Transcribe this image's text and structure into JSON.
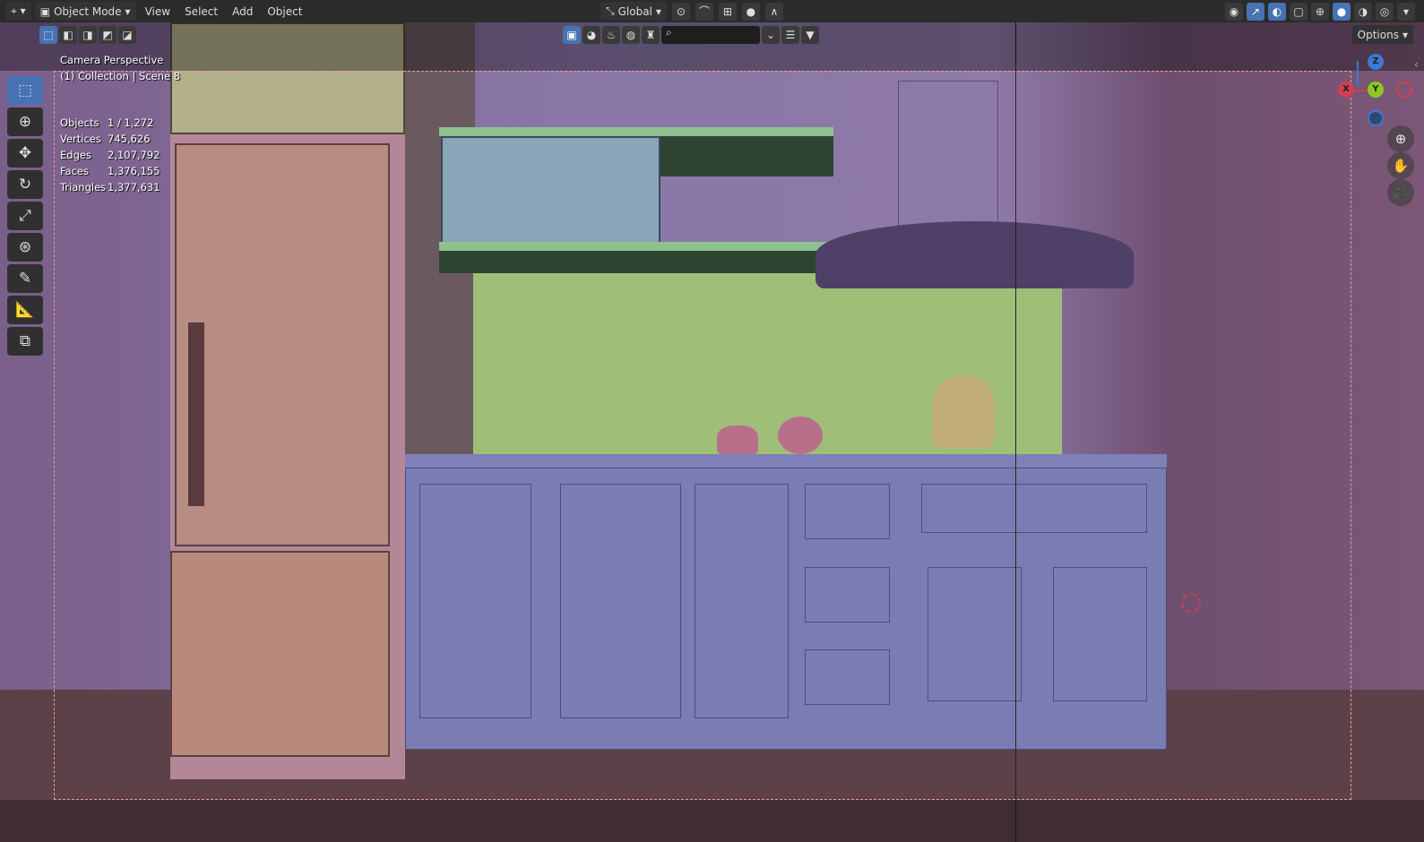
{
  "header": {
    "mode": "Object Mode",
    "menus": [
      "View",
      "Select",
      "Add",
      "Object"
    ],
    "orientation": "Global",
    "options": "Options"
  },
  "overlay": {
    "view_name": "Camera Perspective",
    "collection": "(1) Collection | Scene 8",
    "stats": [
      {
        "label": "Objects",
        "value": "1 / 1,272"
      },
      {
        "label": "Vertices",
        "value": "745,626"
      },
      {
        "label": "Edges",
        "value": "2,107,792"
      },
      {
        "label": "Faces",
        "value": "1,376,155"
      },
      {
        "label": "Triangles",
        "value": "1,377,631"
      }
    ]
  },
  "gizmo": {
    "z": "Z",
    "y": "Y",
    "x": "X"
  },
  "colors": {
    "accent": "#4772b3",
    "header": "#2b2b2b",
    "camera_frame": "#e8a090"
  }
}
